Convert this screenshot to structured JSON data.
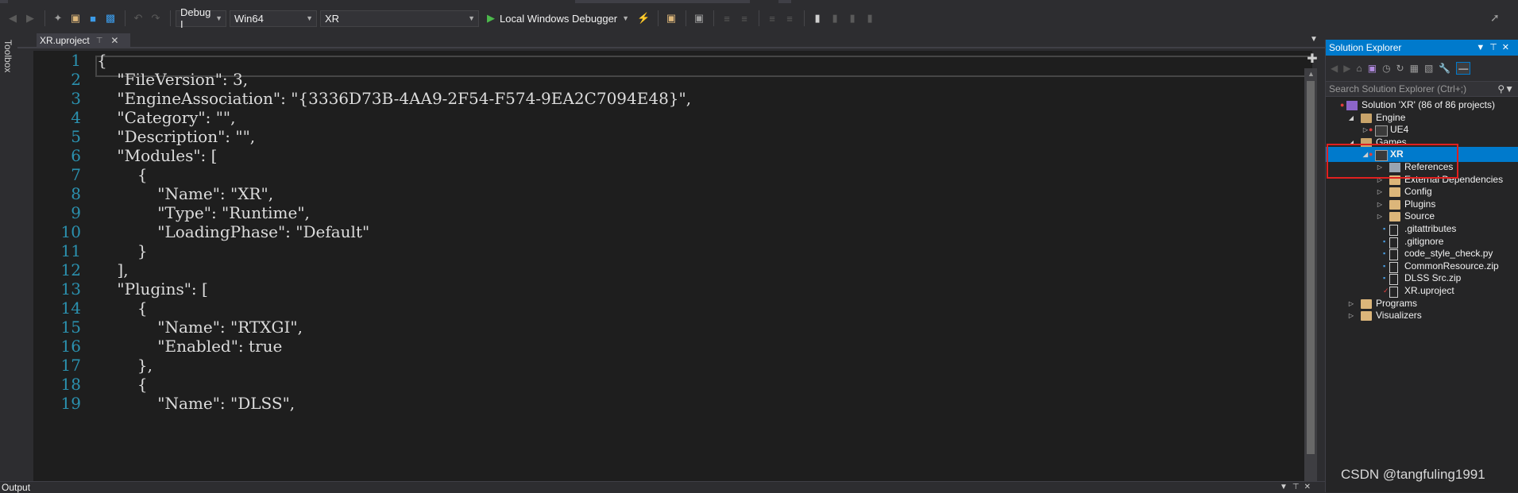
{
  "toolbar": {
    "configuration": "Debug I",
    "platform": "Win64",
    "startup_project": "XR",
    "run_label": "Local Windows Debugger"
  },
  "toolbox": {
    "label": "Toolbox"
  },
  "document_tab": {
    "title": "XR.uproject"
  },
  "editor": {
    "lines": [
      {
        "n": "1",
        "text": "{"
      },
      {
        "n": "2",
        "text": "    \"FileVersion\": 3,"
      },
      {
        "n": "3",
        "text": "    \"EngineAssociation\": \"{3336D73B-4AA9-2F54-F574-9EA2C7094E48}\","
      },
      {
        "n": "4",
        "text": "    \"Category\": \"\","
      },
      {
        "n": "5",
        "text": "    \"Description\": \"\","
      },
      {
        "n": "6",
        "text": "    \"Modules\": ["
      },
      {
        "n": "7",
        "text": "        {"
      },
      {
        "n": "8",
        "text": "            \"Name\": \"XR\","
      },
      {
        "n": "9",
        "text": "            \"Type\": \"Runtime\","
      },
      {
        "n": "10",
        "text": "            \"LoadingPhase\": \"Default\""
      },
      {
        "n": "11",
        "text": "        }"
      },
      {
        "n": "12",
        "text": "    ],"
      },
      {
        "n": "13",
        "text": "    \"Plugins\": ["
      },
      {
        "n": "14",
        "text": "        {"
      },
      {
        "n": "15",
        "text": "            \"Name\": \"RTXGI\","
      },
      {
        "n": "16",
        "text": "            \"Enabled\": true"
      },
      {
        "n": "17",
        "text": "        },"
      },
      {
        "n": "18",
        "text": "        {"
      },
      {
        "n": "19",
        "text": "            \"Name\": \"DLSS\","
      }
    ]
  },
  "output": {
    "label": "Output"
  },
  "solution_explorer": {
    "title": "Solution Explorer",
    "search_placeholder": "Search Solution Explorer (Ctrl+;)",
    "tree": [
      {
        "label": "Solution 'XR' (86 of 86 projects)",
        "depth": 0,
        "icon": "solution-icon",
        "arrow": "",
        "mark": "error"
      },
      {
        "label": "Engine",
        "depth": 1,
        "icon": "folder-open-icon",
        "arrow": "expanded",
        "mark": ""
      },
      {
        "label": "UE4",
        "depth": 2,
        "icon": "project-icon",
        "arrow": "collapsed",
        "mark": "error"
      },
      {
        "label": "Games",
        "depth": 1,
        "icon": "folder-open-icon",
        "arrow": "expanded",
        "mark": ""
      },
      {
        "label": "XR",
        "depth": 2,
        "icon": "project-icon",
        "arrow": "expanded",
        "mark": "error",
        "selected": true
      },
      {
        "label": "References",
        "depth": 3,
        "icon": "references-icon",
        "arrow": "collapsed",
        "mark": ""
      },
      {
        "label": "External Dependencies",
        "depth": 3,
        "icon": "folder-icon",
        "arrow": "collapsed",
        "mark": ""
      },
      {
        "label": "Config",
        "depth": 3,
        "icon": "folder-icon",
        "arrow": "collapsed",
        "mark": ""
      },
      {
        "label": "Plugins",
        "depth": 3,
        "icon": "folder-icon",
        "arrow": "collapsed",
        "mark": ""
      },
      {
        "label": "Source",
        "depth": 3,
        "icon": "folder-icon",
        "arrow": "collapsed",
        "mark": ""
      },
      {
        "label": ".gitattributes",
        "depth": 3,
        "icon": "file-icon",
        "arrow": "",
        "mark": "lock"
      },
      {
        "label": ".gitignore",
        "depth": 3,
        "icon": "file-icon",
        "arrow": "",
        "mark": "lock"
      },
      {
        "label": "code_style_check.py",
        "depth": 3,
        "icon": "file-icon",
        "arrow": "",
        "mark": "lock"
      },
      {
        "label": "CommonResource.zip",
        "depth": 3,
        "icon": "file-icon",
        "arrow": "",
        "mark": "lock"
      },
      {
        "label": "DLSS Src.zip",
        "depth": 3,
        "icon": "file-icon",
        "arrow": "",
        "mark": "lock"
      },
      {
        "label": "XR.uproject",
        "depth": 3,
        "icon": "file-icon",
        "arrow": "",
        "mark": "check"
      },
      {
        "label": "Programs",
        "depth": 1,
        "icon": "folder-icon",
        "arrow": "collapsed",
        "mark": ""
      },
      {
        "label": "Visualizers",
        "depth": 1,
        "icon": "folder-icon",
        "arrow": "collapsed",
        "mark": ""
      }
    ]
  },
  "watermark": "CSDN @tangfuling1991",
  "colors": {
    "accent": "#007acc",
    "highlight_box": "#e0201f",
    "line_number": "#2b91af",
    "editor_bg": "#1e1e1e"
  }
}
